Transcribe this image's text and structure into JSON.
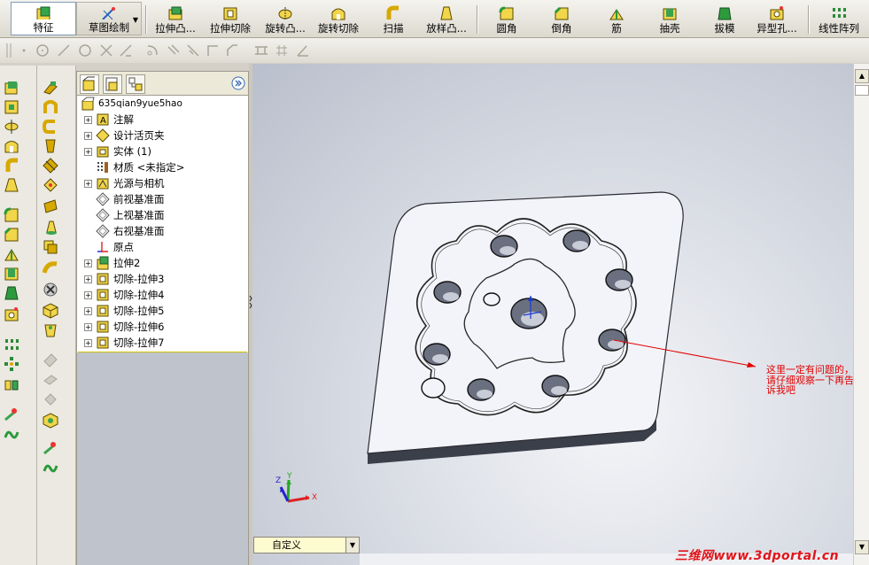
{
  "toolbar": {
    "feature_tab": "特征",
    "sketch_tab": "草图绘制",
    "buttons": [
      "拉伸凸...",
      "拉伸切除",
      "旋转凸...",
      "旋转切除",
      "扫描",
      "放样凸...",
      "圆角",
      "倒角",
      "筋",
      "抽壳",
      "拔模",
      "异型孔...",
      "线性阵列"
    ]
  },
  "tree": {
    "root": "635qian9yue5hao",
    "items": [
      {
        "label": "注解",
        "expandable": true,
        "icon": "annotation-icon"
      },
      {
        "label": "设计活页夹",
        "expandable": true,
        "icon": "design-binder-icon"
      },
      {
        "label": "实体 (1)",
        "expandable": true,
        "icon": "solid-bodies-icon"
      },
      {
        "label": "材质 <未指定>",
        "expandable": false,
        "icon": "material-icon"
      },
      {
        "label": "光源与相机",
        "expandable": true,
        "icon": "lights-cameras-icon"
      },
      {
        "label": "前视基准面",
        "expandable": false,
        "icon": "plane-icon"
      },
      {
        "label": "上视基准面",
        "expandable": false,
        "icon": "plane-icon"
      },
      {
        "label": "右视基准面",
        "expandable": false,
        "icon": "plane-icon"
      },
      {
        "label": "原点",
        "expandable": false,
        "icon": "origin-icon"
      },
      {
        "label": "拉伸2",
        "expandable": true,
        "icon": "extrude-icon"
      },
      {
        "label": "切除-拉伸3",
        "expandable": true,
        "icon": "cut-extrude-icon"
      },
      {
        "label": "切除-拉伸4",
        "expandable": true,
        "icon": "cut-extrude-icon"
      },
      {
        "label": "切除-拉伸5",
        "expandable": true,
        "icon": "cut-extrude-icon"
      },
      {
        "label": "切除-拉伸6",
        "expandable": true,
        "icon": "cut-extrude-icon"
      },
      {
        "label": "切除-拉伸7",
        "expandable": true,
        "icon": "cut-extrude-icon"
      }
    ]
  },
  "view": {
    "orientation": "自定义",
    "annotation_lines": [
      "这里一定有问题的，",
      "请仔细观察一下再告",
      "诉我吧"
    ],
    "triad_labels": {
      "x": "X",
      "y": "Y",
      "z": "Z"
    }
  },
  "watermark": "三维网www.3dportal.cn",
  "colors": {
    "annotation": "#e00000",
    "rollback_bar": "#d2c400",
    "viewport_edge": "#b9bfcc"
  }
}
